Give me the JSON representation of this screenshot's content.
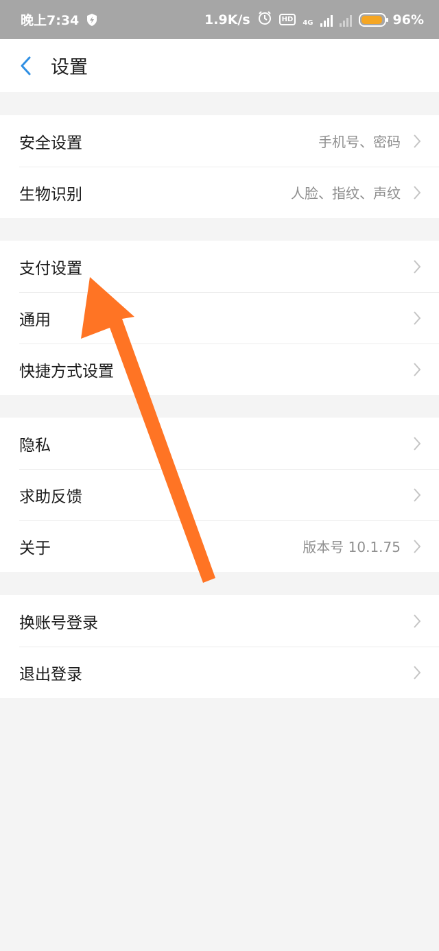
{
  "status_bar": {
    "time": "晚上7:34",
    "net_speed": "1.9K/s",
    "hd": "HD",
    "network": "4G",
    "battery": "96%",
    "battery_level": 0.96
  },
  "nav": {
    "title": "设置"
  },
  "groups": [
    {
      "rows": [
        {
          "label": "安全设置",
          "value": "手机号、密码"
        },
        {
          "label": "生物识别",
          "value": "人脸、指纹、声纹"
        }
      ]
    },
    {
      "rows": [
        {
          "label": "支付设置",
          "value": ""
        },
        {
          "label": "通用",
          "value": ""
        },
        {
          "label": "快捷方式设置",
          "value": ""
        }
      ]
    },
    {
      "rows": [
        {
          "label": "隐私",
          "value": ""
        },
        {
          "label": "求助反馈",
          "value": ""
        },
        {
          "label": "关于",
          "value": "版本号 10.1.75"
        }
      ]
    },
    {
      "rows": [
        {
          "label": "换账号登录",
          "value": ""
        },
        {
          "label": "退出登录",
          "value": ""
        }
      ]
    }
  ],
  "colors": {
    "accent": "#2f8fe3",
    "annotation_arrow": "#ff7424",
    "status_bar": "#a6a6a6"
  }
}
